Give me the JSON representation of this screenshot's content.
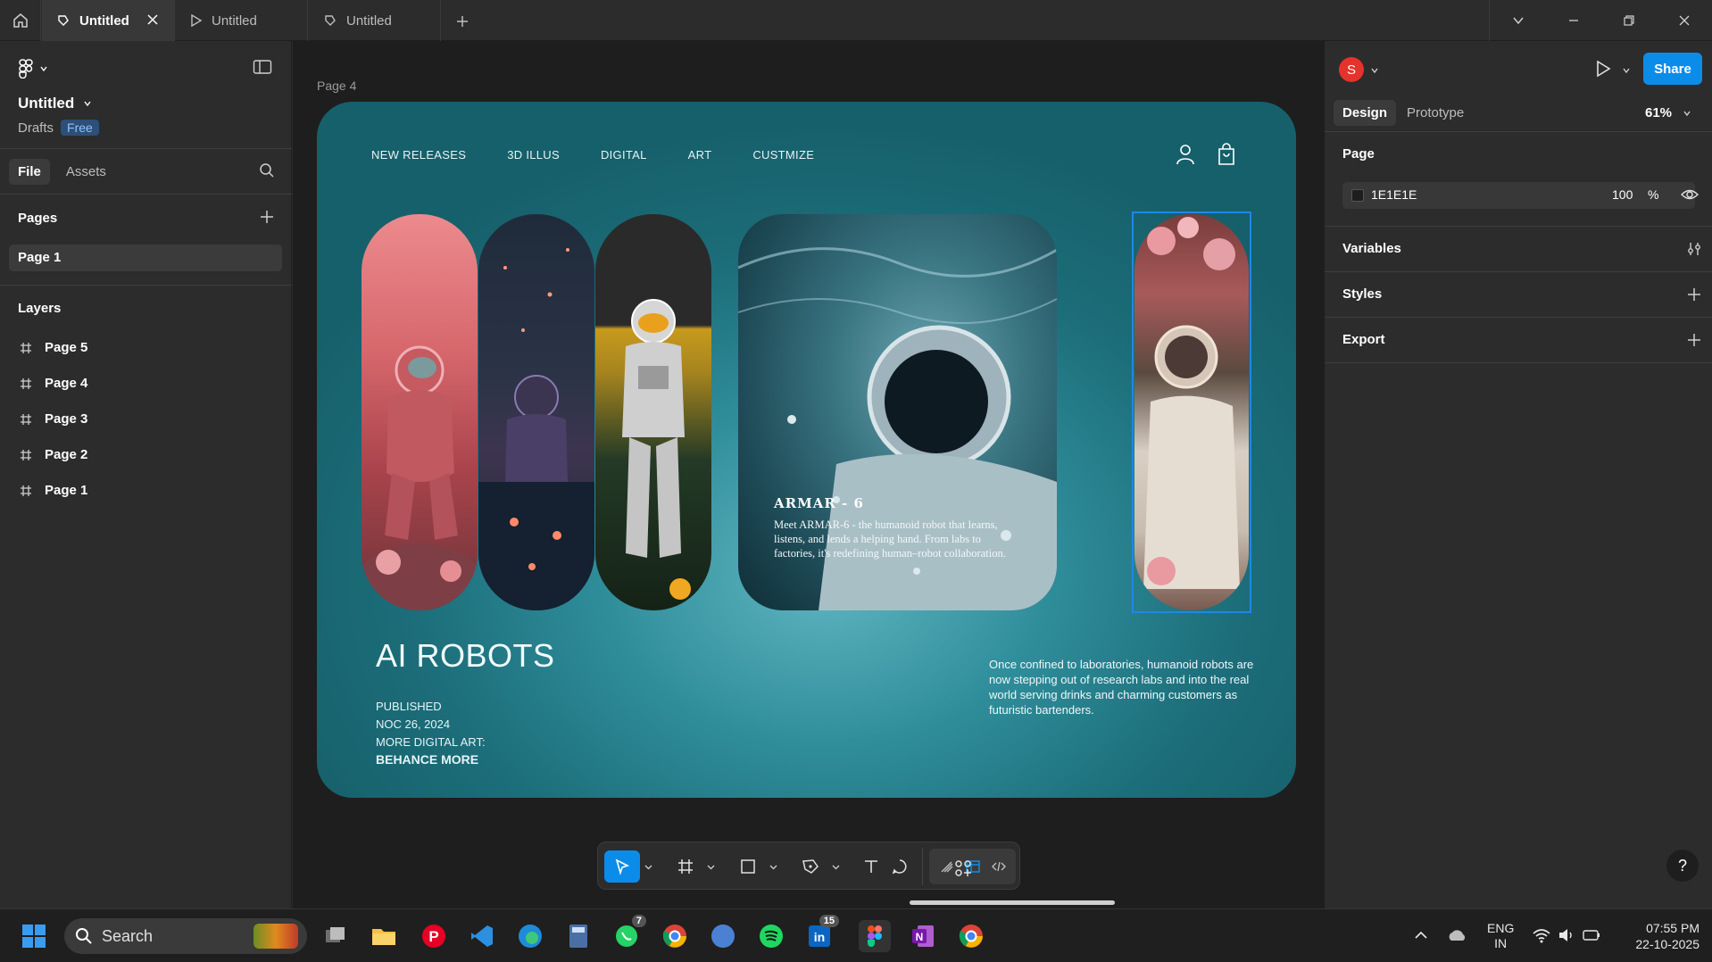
{
  "tabs": [
    {
      "label": "Untitled",
      "active": true
    },
    {
      "label": "Untitled",
      "active": false
    },
    {
      "label": "Untitled",
      "active": false
    }
  ],
  "left_panel": {
    "file_title": "Untitled",
    "location": "Drafts",
    "plan_badge": "Free",
    "tabs": [
      "File",
      "Assets"
    ],
    "pages_title": "Pages",
    "current_page": "Page 1",
    "layers_title": "Layers",
    "layers": [
      "Page 5",
      "Page 4",
      "Page 3",
      "Page 2",
      "Page 1"
    ]
  },
  "canvas": {
    "frame_label": "Page 4",
    "nav": [
      "NEW RELEASES",
      "3D ILLUS",
      "DIGITAL",
      "ART",
      "CUSTMIZE"
    ],
    "headline": "AI ROBOTS",
    "meta": {
      "published": "PUBLISHED",
      "date": "NOC 26, 2024",
      "more": "MORE DIGITAL ART:",
      "link": "BEHANCE MORE"
    },
    "card_title": "ARMAR - 6",
    "card_text": "Meet ARMAR-6 - the humanoid robot that learns, listens, and lends a helping hand. From labs to factories, it's redefining human–robot collaboration.",
    "side_text": "Once confined to laboratories, humanoid robots are now stepping out of research labs and into the real world serving drinks and charming  customers as futuristic bartenders."
  },
  "right_panel": {
    "avatar_letter": "S",
    "share_label": "Share",
    "tabs": [
      "Design",
      "Prototype"
    ],
    "zoom": "61%",
    "page_section": "Page",
    "page_color": "1E1E1E",
    "page_opacity": "100",
    "percent": "%",
    "variables": "Variables",
    "styles": "Styles",
    "export": "Export",
    "help": "?"
  },
  "taskbar": {
    "search": "Search",
    "whatsapp_badge": "7",
    "linkedin_badge": "15",
    "lang": "ENG",
    "region": "IN",
    "time": "07:55 PM",
    "date": "22-10-2025"
  },
  "colors": {
    "accent": "#0c8ce9",
    "frame_teal": "#1c6e7a",
    "avatar": "#e5322b"
  }
}
